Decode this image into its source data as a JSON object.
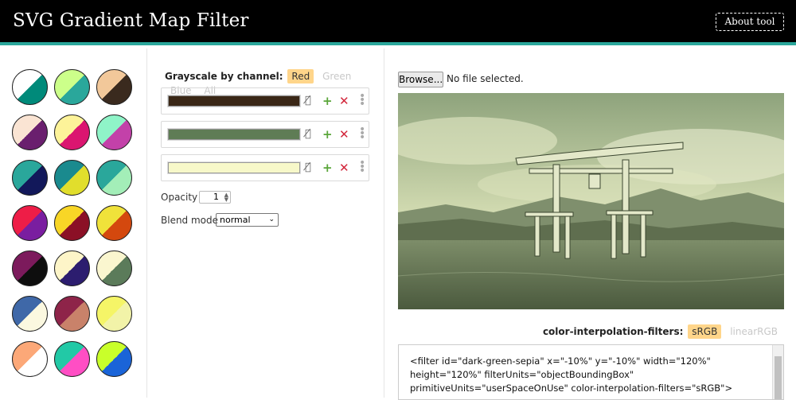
{
  "header": {
    "title": "SVG Gradient Map Filter",
    "about_label": "About tool"
  },
  "presets": [
    [
      "#ffffff",
      "#008a7a"
    ],
    [
      "#ccff8a",
      "#2aa79b"
    ],
    [
      "#f2c89a",
      "#3a2a1e"
    ],
    [
      "#fae4d3",
      "#6a1f6e"
    ],
    [
      "#fdf399",
      "#db1570"
    ],
    [
      "#8ff4c8",
      "#c341a9"
    ],
    [
      "#2aa79b",
      "#12185a"
    ],
    [
      "#1a8a8e",
      "#e1de2c"
    ],
    [
      "#2aa79b",
      "#a3eeb8"
    ],
    [
      "#ee1d47",
      "#7a1ea0"
    ],
    [
      "#f8d626",
      "#8b1026"
    ],
    [
      "#f0e23a",
      "#d4480e"
    ],
    [
      "#7c1a5c",
      "#0e0e0e"
    ],
    [
      "#fdf5c8",
      "#2c1d6f"
    ],
    [
      "#faf6cf",
      "#5b7b5a"
    ],
    [
      "#3f68a8",
      "#fbf8e0"
    ],
    [
      "#8e2449",
      "#c9826a"
    ],
    [
      "#f5f567",
      "#f2f3a8"
    ],
    [
      "#fca878",
      "#ffffff"
    ],
    [
      "#22c9a6",
      "#ff4ec4"
    ],
    [
      "#c9ff2a",
      "#1a64d8"
    ]
  ],
  "channel": {
    "label": "Grayscale by channel:",
    "options": [
      "Red",
      "Green",
      "Blue",
      "All"
    ],
    "active": "Red"
  },
  "stops": [
    {
      "color": "#3a2716"
    },
    {
      "color": "#5f7c55"
    },
    {
      "color": "#f7f8c9"
    }
  ],
  "icons": {
    "visibility": "eye-off-icon",
    "add": "plus-icon",
    "remove": "close-icon",
    "drag": "drag-handle-icon"
  },
  "opacity": {
    "label": "Opacity",
    "value": "1"
  },
  "blend": {
    "label": "Blend mode",
    "value": "normal"
  },
  "file": {
    "button_label": "Browse...",
    "status": "No file selected."
  },
  "color_interpolation": {
    "label": "color-interpolation-filters:",
    "options": [
      "sRGB",
      "linearRGB"
    ],
    "active": "sRGB"
  },
  "code": "<filter id=\"dark-green-sepia\" x=\"-10%\" y=\"-10%\" width=\"120%\" height=\"120%\" filterUnits=\"objectBoundingBox\" primitiveUnits=\"userSpaceOnUse\" color-interpolation-filters=\"sRGB\">",
  "colors": {
    "accent": "#2aa79b",
    "highlight": "#ffd58a",
    "plus": "#5aa63a",
    "remove": "#d2263b"
  }
}
